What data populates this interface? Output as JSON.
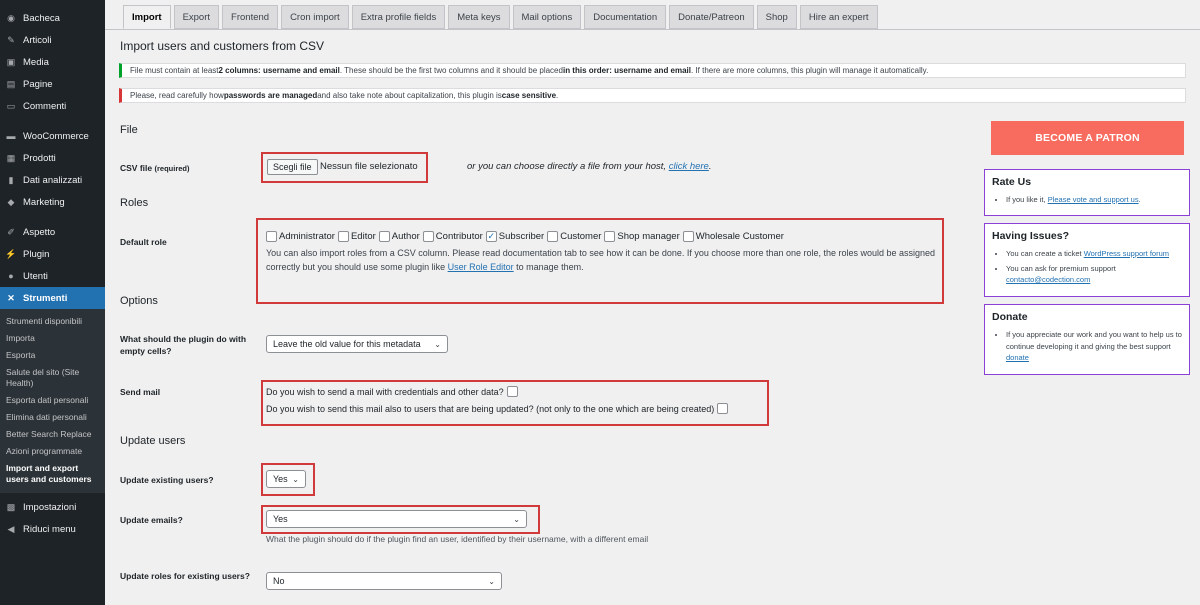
{
  "sidebar": {
    "items_top": [
      {
        "label": "Bacheca",
        "icon": "dashboard-icon"
      },
      {
        "label": "Articoli",
        "icon": "pin-icon"
      },
      {
        "label": "Media",
        "icon": "media-icon"
      },
      {
        "label": "Pagine",
        "icon": "page-icon"
      },
      {
        "label": "Commenti",
        "icon": "comment-icon"
      }
    ],
    "items_shop": [
      {
        "label": "WooCommerce",
        "icon": "woocommerce-icon"
      },
      {
        "label": "Prodotti",
        "icon": "products-icon"
      },
      {
        "label": "Dati analizzati",
        "icon": "analytics-icon"
      },
      {
        "label": "Marketing",
        "icon": "marketing-icon"
      }
    ],
    "items_admin": [
      {
        "label": "Aspetto",
        "icon": "brush-icon"
      },
      {
        "label": "Plugin",
        "icon": "plugin-icon"
      },
      {
        "label": "Utenti",
        "icon": "users-icon"
      },
      {
        "label": "Strumenti",
        "icon": "wrench-icon"
      }
    ],
    "submenu": [
      "Strumenti disponibili",
      "Importa",
      "Esporta",
      "Salute del sito (Site Health)",
      "Esporta dati personali",
      "Elimina dati personali",
      "Better Search Replace",
      "Azioni programmate",
      "Import and export users and customers"
    ],
    "items_bottom": [
      {
        "label": "Impostazioni",
        "icon": "settings-icon"
      },
      {
        "label": "Riduci menu",
        "icon": "collapse-icon"
      }
    ]
  },
  "tabs": [
    "Import",
    "Export",
    "Frontend",
    "Cron import",
    "Extra profile fields",
    "Meta keys",
    "Mail options",
    "Documentation",
    "Donate/Patreon",
    "Shop",
    "Hire an expert"
  ],
  "page_title": "Import users and customers from CSV",
  "notice_green": {
    "t1": "File must contain at least ",
    "b1": "2 columns: username and email",
    "t2": ". These should be the first two columns and it should be placed ",
    "b2": "in this order: username and email",
    "t3": ". If there are more columns, this plugin will manage it automatically."
  },
  "notice_red": {
    "t1": "Please, read carefully how ",
    "b1": "passwords are managed",
    "t2": " and also take note about capitalization, this plugin is ",
    "b2": "case sensitive",
    "t3": "."
  },
  "file_section": {
    "heading": "File",
    "csv_label": "CSV file",
    "csv_required": "(required)",
    "choose_button": "Scegli file",
    "no_file": "Nessun file selezionato",
    "host_text": "or you can choose directly a file from your host, ",
    "host_link": "click here",
    "host_end": "."
  },
  "roles_section": {
    "heading": "Roles",
    "label": "Default role",
    "roles": [
      {
        "name": "Administrator",
        "checked": false
      },
      {
        "name": "Editor",
        "checked": false
      },
      {
        "name": "Author",
        "checked": false
      },
      {
        "name": "Contributor",
        "checked": false
      },
      {
        "name": "Subscriber",
        "checked": true
      },
      {
        "name": "Customer",
        "checked": false
      },
      {
        "name": "Shop manager",
        "checked": false
      },
      {
        "name": "Wholesale Customer",
        "checked": false
      }
    ],
    "note_start": "You can also import roles from a CSV column. Please read documentation tab to see how it can be done. If you choose more than one role, the roles would be assigned correctly but you should use some plugin like ",
    "note_link": "User Role Editor",
    "note_end": " to manage them."
  },
  "options_section": {
    "heading": "Options",
    "empty_label": "What should the plugin do with empty cells?",
    "empty_value": "Leave the old value for this metadata",
    "mail_label": "Send mail",
    "mail_q1": "Do you wish to send a mail with credentials and other data?",
    "mail_q2": "Do you wish to send this mail also to users that are being updated? (not only to the one which are being created)"
  },
  "update_section": {
    "heading": "Update users",
    "existing_label": "Update existing users?",
    "existing_value": "Yes",
    "emails_label": "Update emails?",
    "emails_value": "Yes",
    "emails_desc": "What the plugin should do if the plugin find an user, identified by their username, with a different email",
    "roles_label": "Update roles for existing users?",
    "roles_value": "No"
  },
  "right": {
    "patron_button": "BECOME A PATRON",
    "rate": {
      "title": "Rate Us",
      "text": "If you like it, ",
      "link": "Please vote and support us",
      "end": "."
    },
    "issues": {
      "title": "Having Issues?",
      "t1": "You can create a ticket ",
      "l1": "WordPress support forum",
      "t2": "You can ask for premium support ",
      "l2": "contacto@codection.com"
    },
    "donate": {
      "title": "Donate",
      "text": "If you appreciate our work and you want to help us to continue developing it and giving the best support ",
      "link": "donate"
    }
  }
}
